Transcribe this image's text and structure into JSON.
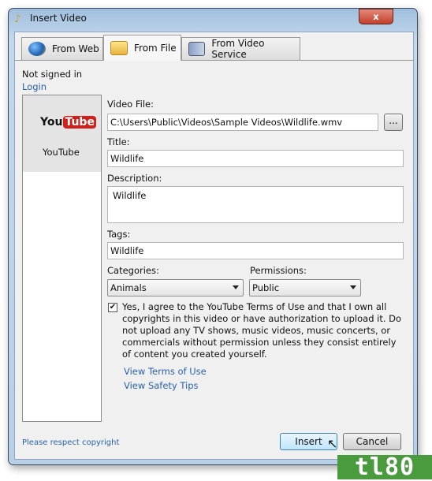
{
  "window": {
    "title": "Insert Video",
    "close_label": "x"
  },
  "tabs": [
    {
      "label": "From Web",
      "icon": "globe-film-icon"
    },
    {
      "label": "From File",
      "icon": "folder-icon",
      "active": true
    },
    {
      "label": "From Video Service",
      "icon": "film-play-icon"
    }
  ],
  "account": {
    "status": "Not signed in",
    "login": "Login"
  },
  "services": [
    {
      "name": "YouTube",
      "logo_a": "You",
      "logo_b": "Tube",
      "selected": true
    }
  ],
  "form": {
    "video_file_label": "Video File:",
    "video_file": "C:\\Users\\Public\\Videos\\Sample Videos\\Wildlife.wmv",
    "browse_label": "...",
    "title_label": "Title:",
    "title": "Wildlife",
    "description_label": "Description:",
    "description": "Wildlife",
    "tags_label": "Tags:",
    "tags": "Wildlife",
    "categories_label": "Categories:",
    "category": "Animals",
    "permissions_label": "Permissions:",
    "permission": "Public",
    "agree_checked": true,
    "agree_text": "Yes, I agree to the YouTube Terms of Use and that I own all copyrights in this video or have authorization to upload it. Do not upload any TV shows, music videos, music concerts, or commercials without permission unless they consist entirely of content you created yourself.",
    "terms_link": "View Terms of Use",
    "safety_link": "View Safety Tips"
  },
  "footer": {
    "copyright_link": "Please respect copyright",
    "insert": "Insert",
    "cancel": "Cancel"
  },
  "watermark": "tl80",
  "colors": {
    "link": "#2a62a8",
    "watermark": "#4a9a3e",
    "youtube_red": "#d0201b"
  }
}
